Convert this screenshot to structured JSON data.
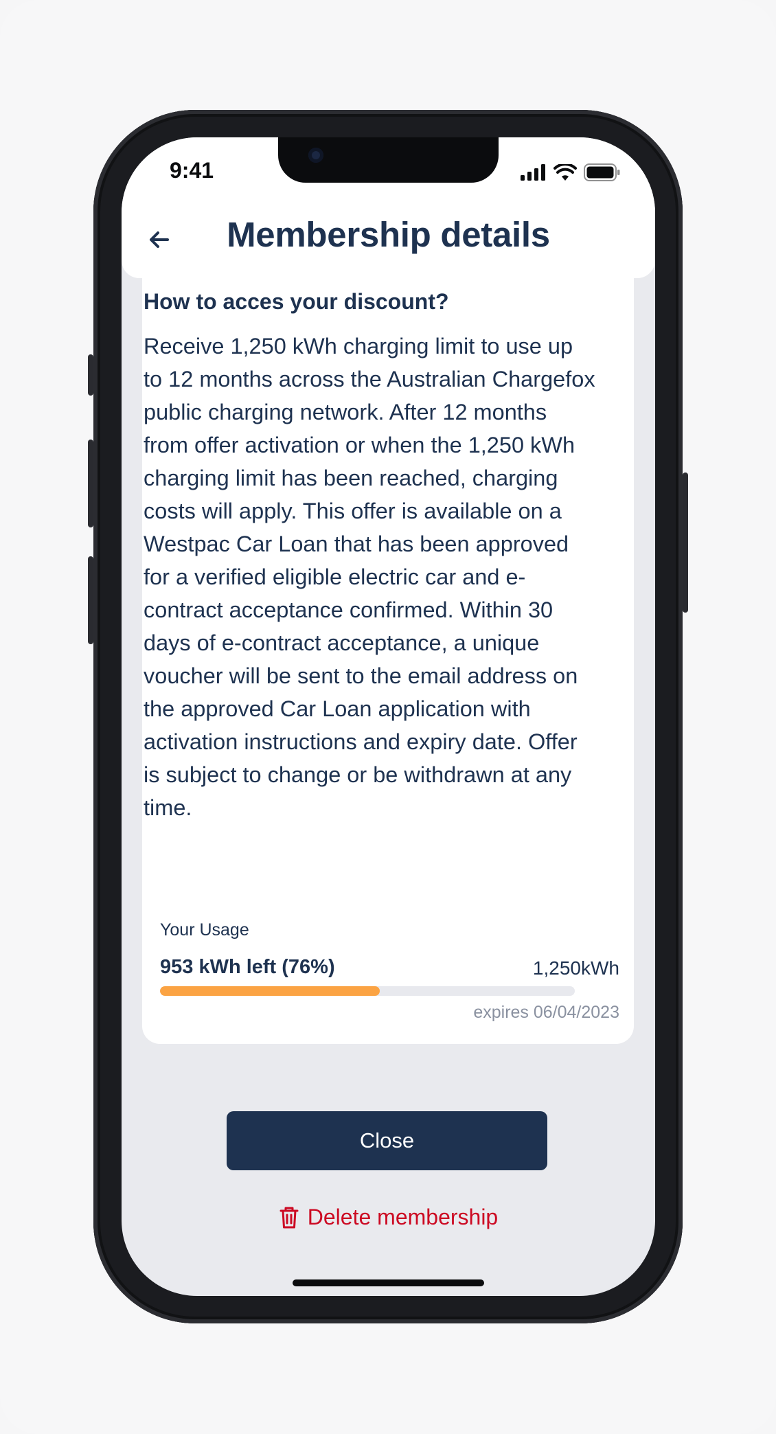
{
  "status_bar": {
    "time": "9:41"
  },
  "header": {
    "title": "Membership details"
  },
  "card": {
    "heading": "How to acces your discount?",
    "body": "Receive 1,250 kWh charging limit to use up to 12 months across the Australian Chargefox public charging network. After 12 months from offer activation or when the 1,250 kWh charging limit has been reached, charging costs will apply. This offer is available on a Westpac Car Loan that has been approved for a verified eligible electric car and e-contract acceptance confirmed. Within 30 days of e-contract acceptance, a unique voucher will be sent to the email address on the approved Car Loan application with activation instructions and expiry date. Offer is subject to change or be withdrawn at any time."
  },
  "usage": {
    "label": "Your Usage",
    "left_text": "953 kWh left (76%)",
    "total_text": "1,250kWh",
    "expires_text": "expires 06/04/2023",
    "progress_fraction": 0.53
  },
  "actions": {
    "close_label": "Close",
    "delete_label": "Delete membership"
  },
  "colors": {
    "primary": "#1e3250",
    "accent_progress": "#fba343",
    "danger": "#cc0a23",
    "screen_bg": "#e9eaee"
  },
  "icons": {
    "back": "arrow-left-icon",
    "delete": "trash-icon",
    "signal": "cellular-signal-icon",
    "wifi": "wifi-icon",
    "battery": "battery-icon"
  }
}
